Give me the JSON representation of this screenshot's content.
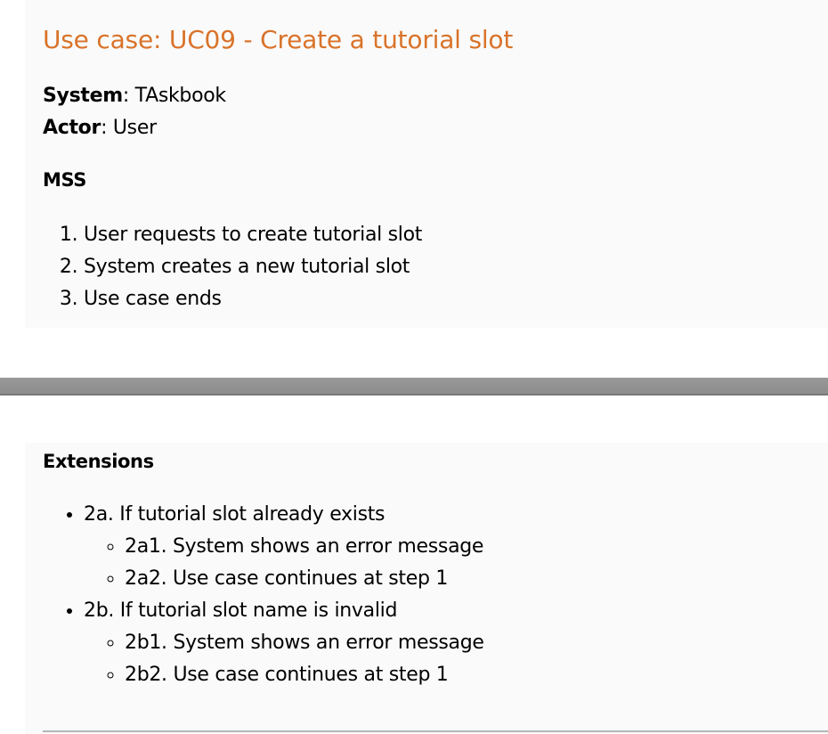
{
  "title": "Use case: UC09 - Create a tutorial slot",
  "system": {
    "label": "System",
    "value": ": TAskbook"
  },
  "actor": {
    "label": "Actor",
    "value": ": User"
  },
  "mss": {
    "heading": "MSS",
    "steps": [
      "User requests to create tutorial slot",
      "System creates a new tutorial slot",
      "Use case ends"
    ]
  },
  "extensions": {
    "heading": "Extensions",
    "items": [
      {
        "text": "2a. If tutorial slot already exists",
        "sub": [
          "2a1. System shows an error message",
          "2a2. Use case continues at step 1"
        ]
      },
      {
        "text": "2b. If tutorial slot name is invalid",
        "sub": [
          "2b1. System shows an error message",
          "2b2. Use case continues at step 1"
        ]
      }
    ]
  },
  "colors": {
    "title": "#d9732a",
    "card_background": "#fafafa",
    "divider": "#8c8c8c"
  }
}
